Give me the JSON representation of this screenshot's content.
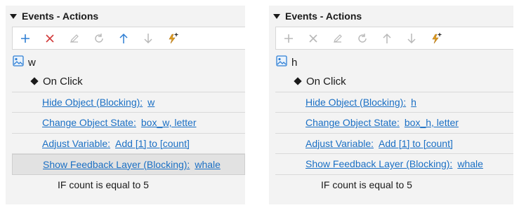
{
  "panels": [
    {
      "header_title": "Events - Actions",
      "object_name": "w",
      "trigger": "On Click",
      "actions": [
        {
          "label": "Hide Object (Blocking):",
          "value": "w"
        },
        {
          "label": "Change Object State:",
          "value": "box_w, letter"
        },
        {
          "label": "Adjust Variable:",
          "value": "Add [1] to [count]"
        },
        {
          "label": "Show Feedback Layer (Blocking):",
          "value": "whale"
        }
      ],
      "condition": "IF count is equal to 5",
      "selected_action_index": 3
    },
    {
      "header_title": "Events - Actions",
      "object_name": "h",
      "trigger": "On Click",
      "actions": [
        {
          "label": "Hide Object (Blocking):",
          "value": "h"
        },
        {
          "label": "Change Object State:",
          "value": "box_h, letter"
        },
        {
          "label": "Adjust Variable:",
          "value": "Add [1] to [count]"
        },
        {
          "label": "Show Feedback Layer (Blocking):",
          "value": "whale"
        }
      ],
      "condition": "IF count is equal to 5",
      "selected_action_index": null
    }
  ],
  "toolbar_icons": [
    "add-icon",
    "delete-icon",
    "edit-icon",
    "redo-icon",
    "move-up-icon",
    "move-down-icon",
    "lightning-add-icon"
  ],
  "colors": {
    "link": "#1a6fc4",
    "add_active": "#2f7fd4",
    "delete_active": "#d23a3a",
    "lightning": "#e0a020",
    "disabled": "#b8b8b8"
  }
}
